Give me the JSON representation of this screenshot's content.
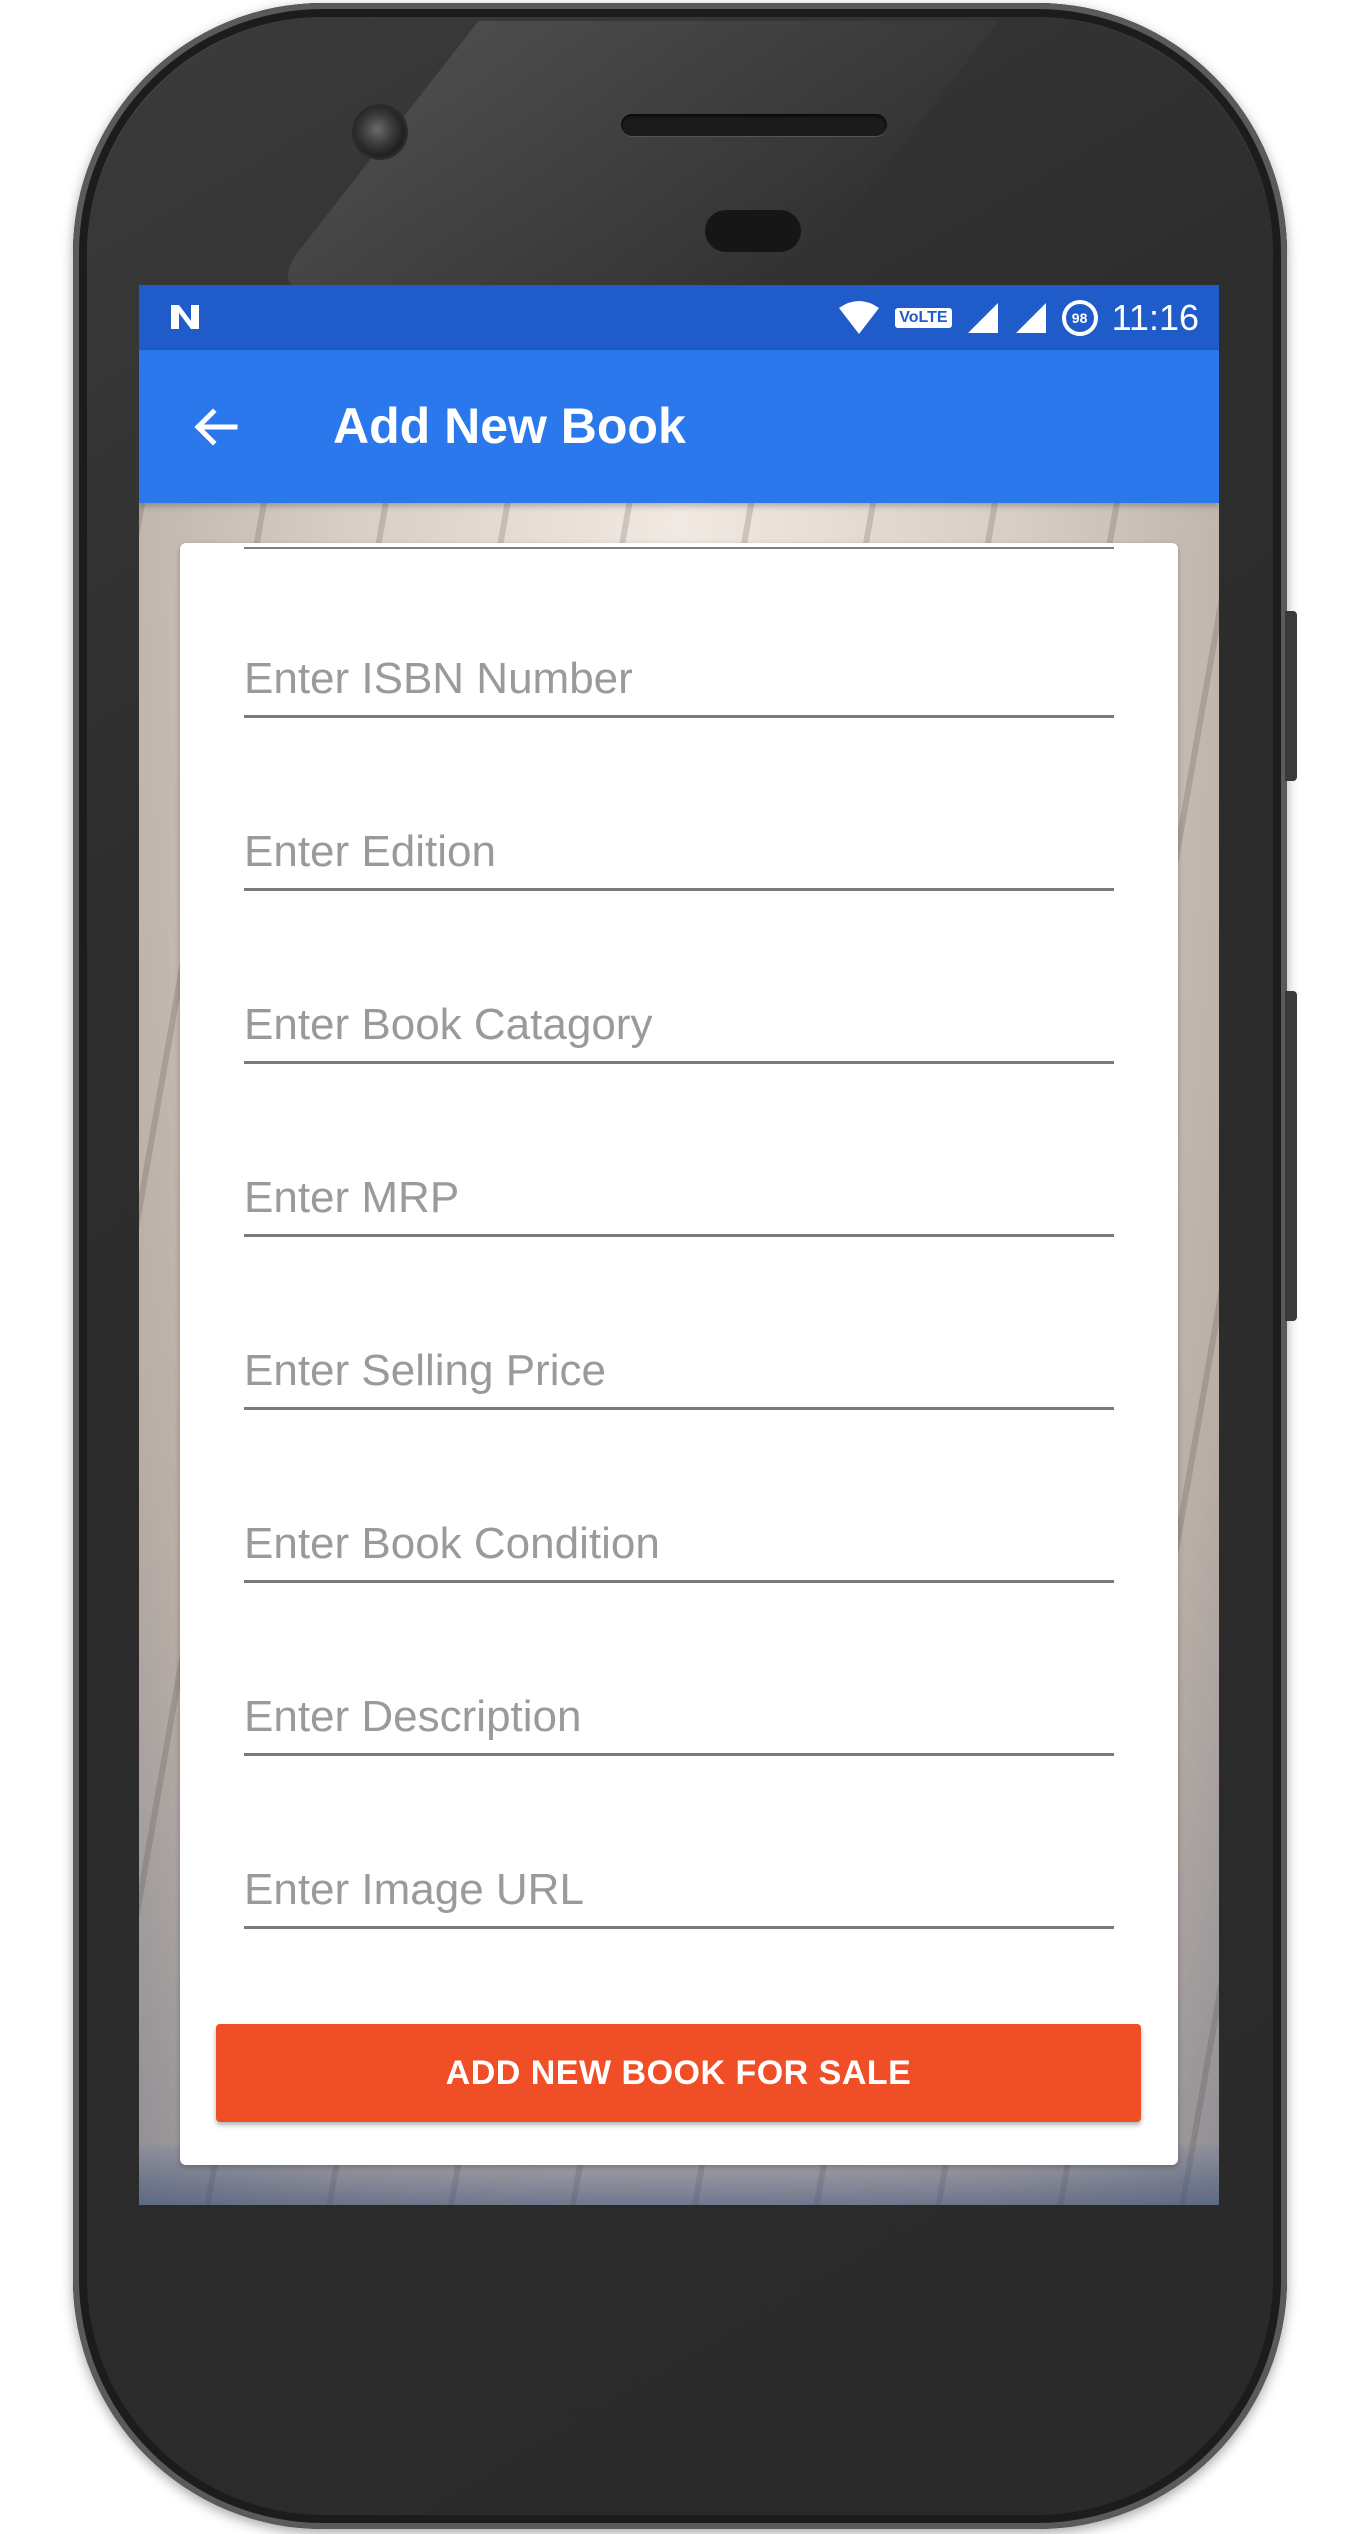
{
  "status_bar": {
    "time": "11:16",
    "network_badge": "VoLTE",
    "battery_level": "98",
    "icons": [
      "notification-n-icon",
      "wifi-icon",
      "signal-icon",
      "signal-icon-2",
      "battery-saver-icon"
    ]
  },
  "app_bar": {
    "title": "Add New Book",
    "back_icon": "arrow-left-icon",
    "color": "#2b78ec",
    "status_color": "#1f5bc9"
  },
  "form": {
    "fields": [
      {
        "placeholder": "Enter ISBN Number",
        "value": ""
      },
      {
        "placeholder": "Enter Edition",
        "value": ""
      },
      {
        "placeholder": "Enter Book Catagory",
        "value": ""
      },
      {
        "placeholder": "Enter MRP",
        "value": ""
      },
      {
        "placeholder": "Enter Selling Price",
        "value": ""
      },
      {
        "placeholder": "Enter Book Condition",
        "value": ""
      },
      {
        "placeholder": "Enter Description",
        "value": ""
      },
      {
        "placeholder": "Enter Image URL",
        "value": ""
      }
    ],
    "submit_label": "ADD NEW BOOK FOR SALE",
    "submit_color": "#f04e26"
  }
}
